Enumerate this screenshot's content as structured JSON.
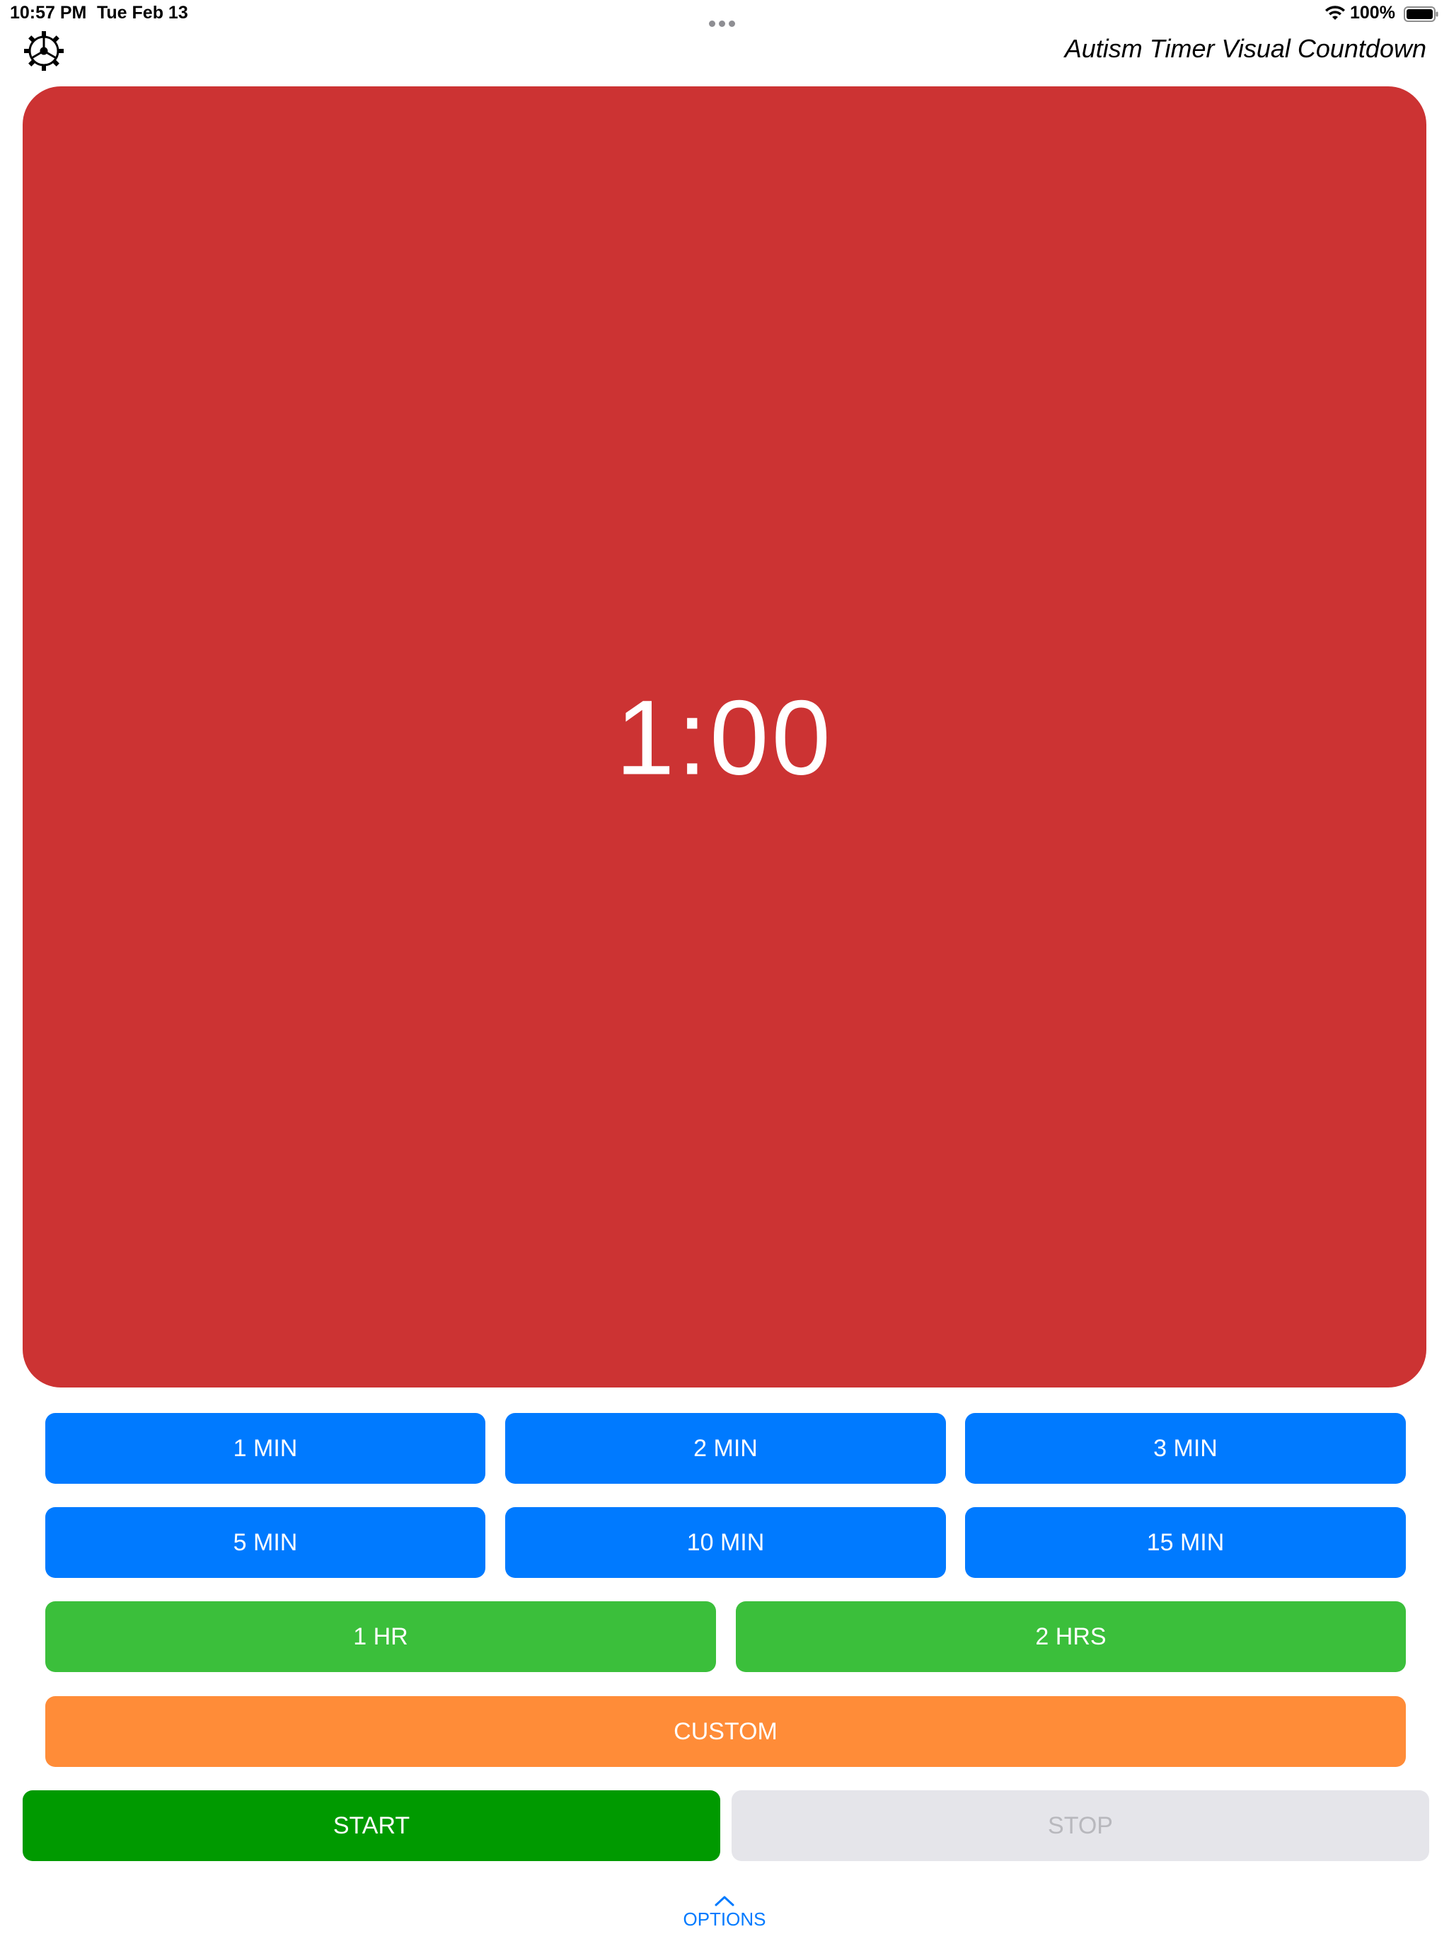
{
  "status_bar": {
    "time": "10:57 PM",
    "date": "Tue Feb 13",
    "battery": "100%",
    "icons": [
      "multitask-dots-icon",
      "wifi-icon",
      "battery-icon"
    ]
  },
  "header": {
    "title": "Autism Timer Visual Countdown",
    "settings_icon": "settings-gear-icon"
  },
  "timer": {
    "value": "1:00",
    "color": "#cc3333"
  },
  "presets": {
    "row1": [
      {
        "label": "1 MIN"
      },
      {
        "label": "2 MIN"
      },
      {
        "label": "3 MIN"
      }
    ],
    "row2": [
      {
        "label": "5 MIN"
      },
      {
        "label": "10 MIN"
      },
      {
        "label": "15 MIN"
      }
    ],
    "row3": [
      {
        "label": "1 HR"
      },
      {
        "label": "2 HRS"
      }
    ],
    "custom": {
      "label": "CUSTOM"
    }
  },
  "controls": {
    "start": {
      "label": "START"
    },
    "stop": {
      "label": "STOP",
      "enabled": false
    }
  },
  "options": {
    "label": "OPTIONS",
    "icon": "chevron-up-icon"
  },
  "colors": {
    "blue": "#007aff",
    "green": "#3bbf3b",
    "orange": "#ff8c38",
    "start_green": "#009a00",
    "stop_gray": "#e5e5ea",
    "timer_red": "#cc3333"
  }
}
